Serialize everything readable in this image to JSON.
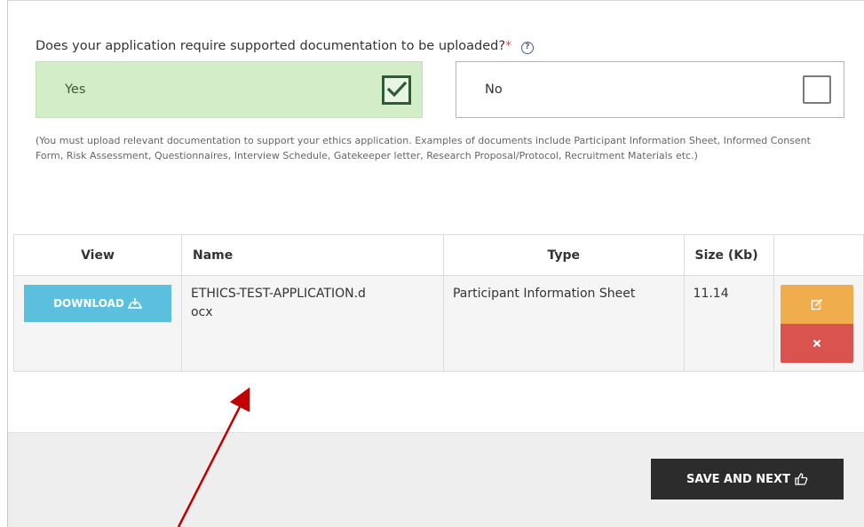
{
  "question": {
    "text": "Does your application require supported documentation to be uploaded?",
    "required_mark": "*",
    "help_icon": "question-circle-icon"
  },
  "options": {
    "yes_label": "Yes",
    "yes_checked": true,
    "no_label": "No",
    "no_checked": false
  },
  "note": "(You must upload relevant documentation to support your ethics application. Examples of documents include Participant Information Sheet, Informed Consent Form, Risk Assessment, Questionnaires, Interview Schedule, Gatekeeper letter, Research Proposal/Protocol, Recruitment Materials etc.)",
  "table": {
    "headers": {
      "view": "View",
      "name": "Name",
      "type": "Type",
      "size": "Size (Kb)"
    },
    "rows": [
      {
        "download_label": "DOWNLOAD",
        "name": "ETHICS-TEST-APPLICATION.docx",
        "type": "Participant Information Sheet",
        "size": "11.14"
      }
    ]
  },
  "footer": {
    "save_label": "SAVE AND NEXT"
  },
  "colors": {
    "yes_bg": "#d4edc9",
    "download_btn": "#5bc0de",
    "edit_btn": "#f0ad4e",
    "delete_btn": "#d9534f",
    "save_btn": "#2c2c2c",
    "annotation_arrow": "#c00000"
  },
  "icons": {
    "download": "download-icon",
    "edit": "edit-icon",
    "delete": "close-icon",
    "save": "thumbs-up-icon",
    "checkmark": "checkmark-icon"
  }
}
